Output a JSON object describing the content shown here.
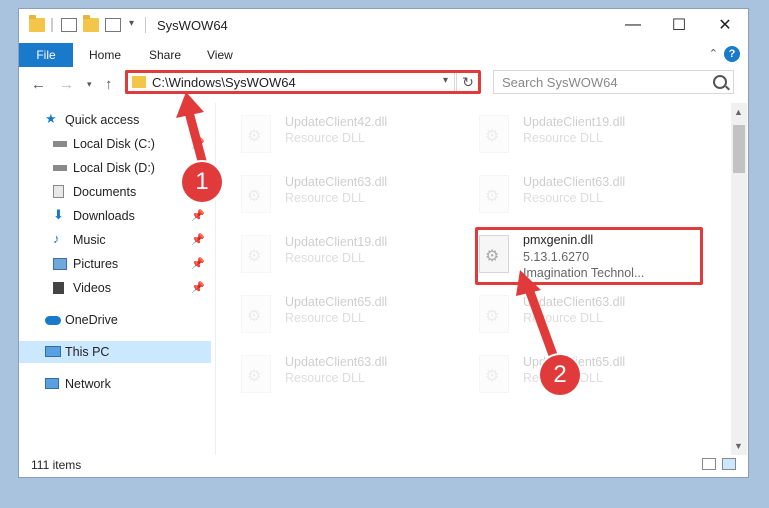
{
  "window": {
    "title": "SysWOW64",
    "minimize": "—",
    "maximize": "☐",
    "close": "✕"
  },
  "ribbon": {
    "tabs": [
      "File",
      "Home",
      "Share",
      "View"
    ],
    "help": "?"
  },
  "address": {
    "path": "C:\\Windows\\SysWOW64",
    "search_placeholder": "Search SysWOW64"
  },
  "nav": {
    "items": [
      {
        "label": "Quick access",
        "icon": "star-icon"
      },
      {
        "label": "Local Disk (C:)",
        "icon": "drive-icon",
        "pinned": true
      },
      {
        "label": "Local Disk (D:)",
        "icon": "drive-icon"
      },
      {
        "label": "Documents",
        "icon": "documents-icon"
      },
      {
        "label": "Downloads",
        "icon": "downloads-icon",
        "pinned": true
      },
      {
        "label": "Music",
        "icon": "music-icon",
        "pinned": true
      },
      {
        "label": "Pictures",
        "icon": "pictures-icon",
        "pinned": true
      },
      {
        "label": "Videos",
        "icon": "videos-icon",
        "pinned": true
      },
      {
        "label": "OneDrive",
        "icon": "cloud-icon"
      },
      {
        "label": "This PC",
        "icon": "computer-icon",
        "selected": true
      },
      {
        "label": "Network",
        "icon": "network-icon"
      }
    ]
  },
  "files": [
    {
      "name": "UpdateClient42.dll",
      "type": "Resource DLL"
    },
    {
      "name": "UpdateClient19.dll",
      "type": "Resource DLL"
    },
    {
      "name": "UpdateClient63.dll",
      "type": "Resource DLL"
    },
    {
      "name": "UpdateClient63.dll",
      "type": "Resource DLL"
    },
    {
      "name": "UpdateClient19.dll",
      "type": "Resource DLL"
    },
    {
      "name": "pmxgenin.dll",
      "version": "5.13.1.6270",
      "company": "Imagination Technol..."
    },
    {
      "name": "UpdateClient65.dll",
      "type": "Resource DLL"
    },
    {
      "name": "UpdateClient63.dll",
      "type": "Resource DLL"
    },
    {
      "name": "UpdateClient63.dll",
      "type": "Resource DLL"
    },
    {
      "name": "UpdateClient65.dll",
      "type": "Resource DLL"
    }
  ],
  "status": {
    "count": "111 items"
  },
  "annotations": {
    "step1": "1",
    "step2": "2"
  },
  "colors": {
    "accent": "#1979ca",
    "callout": "#e03a3a"
  }
}
